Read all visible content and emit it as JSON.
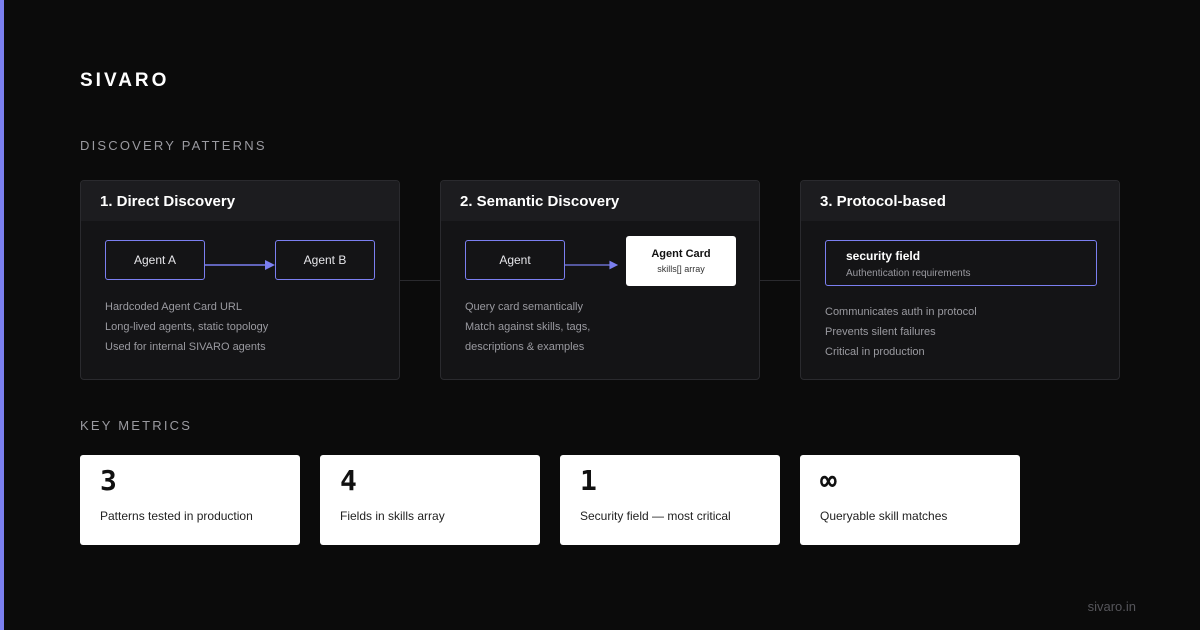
{
  "brand": "SIVARO",
  "sections": {
    "patterns": "DISCOVERY PATTERNS",
    "metrics": "KEY METRICS"
  },
  "colors": {
    "accent": "#7b7ff0",
    "background": "#0b0b0b",
    "card": "#141416"
  },
  "patterns": [
    {
      "title": "1. Direct Discovery",
      "nodes": [
        "Agent A",
        "Agent B"
      ],
      "lines": [
        "Hardcoded Agent Card URL",
        "Long-lived agents, static topology",
        "Used for internal SIVARO agents"
      ]
    },
    {
      "title": "2. Semantic Discovery",
      "nodes": [
        "Agent"
      ],
      "target": {
        "title": "Agent Card",
        "subtitle": "skills[] array"
      },
      "lines": [
        "Query card semantically",
        "Match against skills, tags,",
        "descriptions & examples"
      ]
    },
    {
      "title": "3. Protocol-based",
      "field": {
        "title": "security field",
        "subtitle": "Authentication requirements"
      },
      "lines": [
        "Communicates auth in protocol",
        "Prevents silent failures",
        "Critical in production"
      ]
    }
  ],
  "metrics": [
    {
      "value": "3",
      "label": "Patterns tested in production"
    },
    {
      "value": "4",
      "label": "Fields in skills array"
    },
    {
      "value": "1",
      "label": "Security field — most critical"
    },
    {
      "value": "∞",
      "label": "Queryable skill matches"
    }
  ],
  "footer": "sivaro.in"
}
